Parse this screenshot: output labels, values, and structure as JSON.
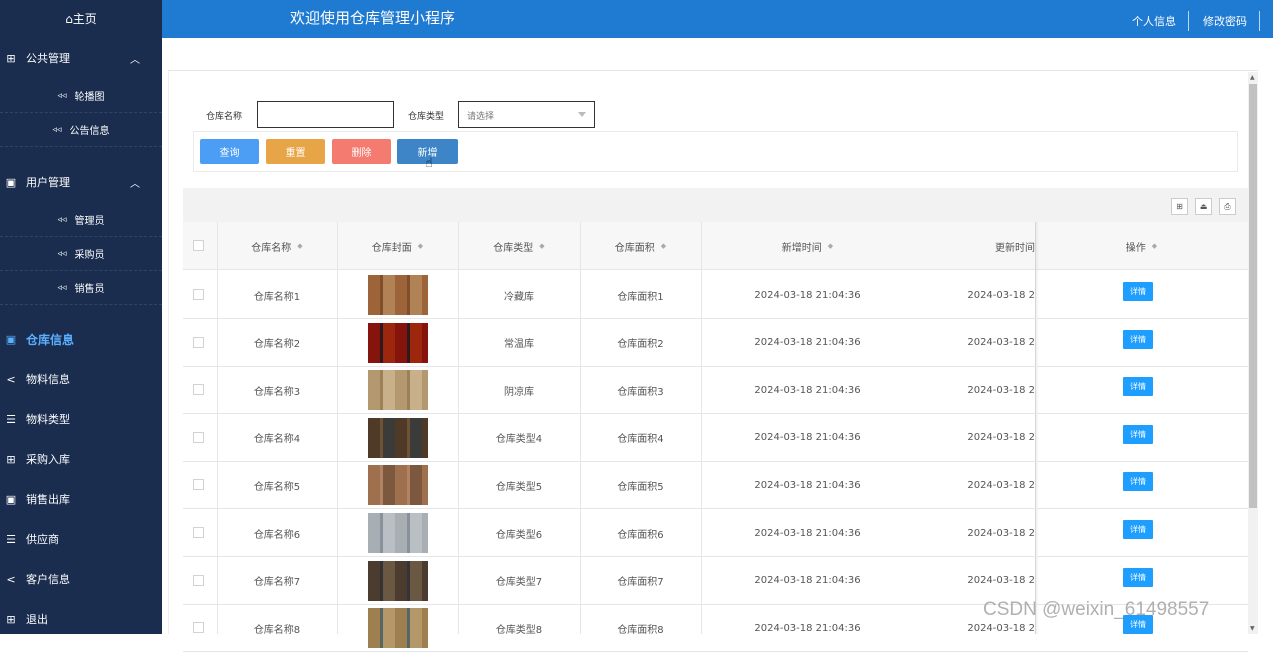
{
  "sidebar": {
    "home_label": "⌂主页",
    "groups": [
      {
        "label": "公共管理",
        "icon": "grid-icon",
        "subitems": [
          "轮播图",
          "公告信息"
        ]
      },
      {
        "label": "用户管理",
        "icon": "clipboard-icon",
        "subitems": [
          "管理员",
          "采购员",
          "销售员"
        ]
      }
    ],
    "items": [
      {
        "label": "仓库信息",
        "icon": "clipboard-icon",
        "active": true
      },
      {
        "label": "物料信息",
        "icon": "share-icon"
      },
      {
        "label": "物料类型",
        "icon": "list-icon"
      },
      {
        "label": "采购入库",
        "icon": "grid-icon"
      },
      {
        "label": "销售出库",
        "icon": "clipboard-icon"
      },
      {
        "label": "供应商",
        "icon": "list-icon"
      },
      {
        "label": "客户信息",
        "icon": "share-icon"
      },
      {
        "label": "退出",
        "icon": "grid-icon"
      }
    ]
  },
  "header": {
    "title": "欢迎使用仓库管理小程序",
    "profile_link": "个人信息",
    "password_link": "修改密码"
  },
  "search": {
    "name_label": "仓库名称",
    "name_value": "",
    "type_label": "仓库类型",
    "type_placeholder": "请选择"
  },
  "buttons": {
    "query": "查询",
    "reset": "重置",
    "delete": "删除",
    "add": "新增"
  },
  "table": {
    "columns": [
      "仓库名称",
      "仓库封面",
      "仓库类型",
      "仓库面积",
      "新增时间",
      "更新时间",
      "操作"
    ],
    "detail_label": "详情",
    "rows": [
      {
        "name": "仓库名称1",
        "type": "冷藏库",
        "area": "仓库面积1",
        "created": "2024-03-18 21:04:36",
        "updated": "2024-03-18 2"
      },
      {
        "name": "仓库名称2",
        "type": "常温库",
        "area": "仓库面积2",
        "created": "2024-03-18 21:04:36",
        "updated": "2024-03-18 2"
      },
      {
        "name": "仓库名称3",
        "type": "阴凉库",
        "area": "仓库面积3",
        "created": "2024-03-18 21:04:36",
        "updated": "2024-03-18 2"
      },
      {
        "name": "仓库名称4",
        "type": "仓库类型4",
        "area": "仓库面积4",
        "created": "2024-03-18 21:04:36",
        "updated": "2024-03-18 2"
      },
      {
        "name": "仓库名称5",
        "type": "仓库类型5",
        "area": "仓库面积5",
        "created": "2024-03-18 21:04:36",
        "updated": "2024-03-18 2"
      },
      {
        "name": "仓库名称6",
        "type": "仓库类型6",
        "area": "仓库面积6",
        "created": "2024-03-18 21:04:36",
        "updated": "2024-03-18 2"
      },
      {
        "name": "仓库名称7",
        "type": "仓库类型7",
        "area": "仓库面积7",
        "created": "2024-03-18 21:04:36",
        "updated": "2024-03-18 2"
      },
      {
        "name": "仓库名称8",
        "type": "仓库类型8",
        "area": "仓库面积8",
        "created": "2024-03-18 21:04:36",
        "updated": "2024-03-18 2"
      }
    ]
  },
  "watermark": "CSDN @weixin_61498557",
  "colors": {
    "sidebar_bg": "#1a2d4f",
    "header_bg": "#1f7ad2",
    "query": "#4c9ef5",
    "reset": "#e8a547",
    "delete": "#f37b6f",
    "add": "#3d85c6",
    "detail": "#1e9fff"
  }
}
